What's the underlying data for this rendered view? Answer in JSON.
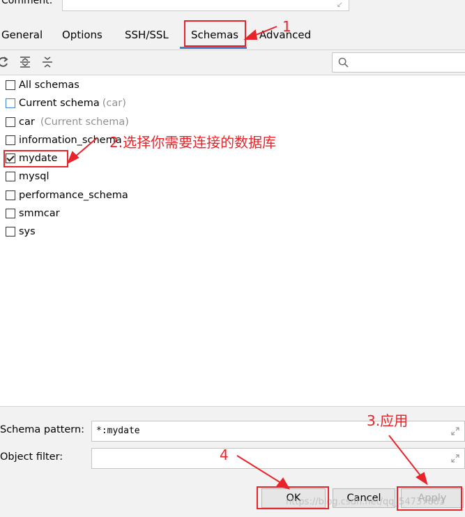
{
  "comment": {
    "label": "Comment:"
  },
  "tabs": [
    {
      "label": "General",
      "active": false
    },
    {
      "label": "Options",
      "active": false
    },
    {
      "label": "SSH/SSL",
      "active": false
    },
    {
      "label": "Schemas",
      "active": true
    },
    {
      "label": "Advanced",
      "active": false
    }
  ],
  "toolbar": {
    "icons": [
      "refresh-icon",
      "expand-all-icon",
      "collapse-all-icon"
    ],
    "search_placeholder": ""
  },
  "schemas": [
    {
      "name": "All schemas",
      "hint": "",
      "checked": false
    },
    {
      "name": "Current schema",
      "hint": "(car)",
      "checked": false
    },
    {
      "name": "car",
      "hint": "(Current schema)",
      "checked": false
    },
    {
      "name": "information_schema",
      "hint": "",
      "checked": false
    },
    {
      "name": "mydate",
      "hint": "",
      "checked": true
    },
    {
      "name": "mysql",
      "hint": "",
      "checked": false
    },
    {
      "name": "performance_schema",
      "hint": "",
      "checked": false
    },
    {
      "name": "smmcar",
      "hint": "",
      "checked": false
    },
    {
      "name": "sys",
      "hint": "",
      "checked": false
    }
  ],
  "fields": {
    "schema_pattern_label": "Schema pattern:",
    "schema_pattern_value": "*:mydate",
    "object_filter_label": "Object filter:",
    "object_filter_value": ""
  },
  "buttons": {
    "ok": "OK",
    "cancel": "Cancel",
    "apply": "Apply"
  },
  "annotations": {
    "step1": "1",
    "step2": "2.选择你需要连接的数据库",
    "step3": "3.应用",
    "step4": "4",
    "color": "#e8242a"
  },
  "watermark": "https://blog.csdn.net/qq_54737883",
  "colors": {
    "accent": "#3c7fd0",
    "annotation": "#e8242a"
  }
}
